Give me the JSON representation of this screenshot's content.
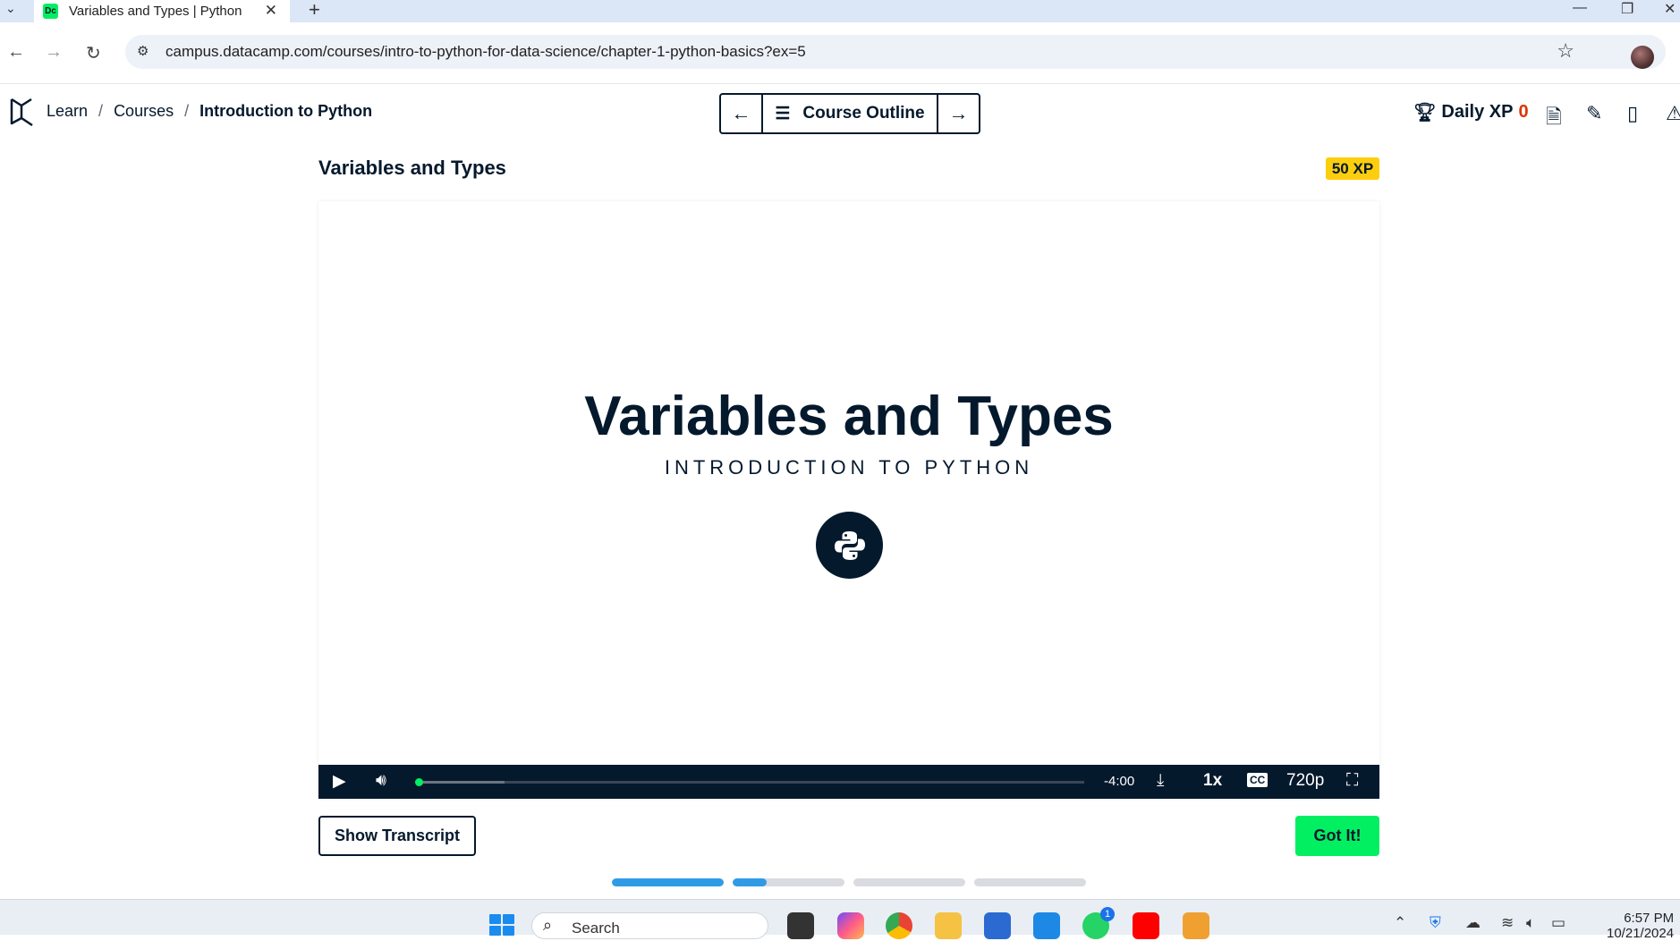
{
  "browser": {
    "tab_title": "Variables and Types | Python",
    "favicon_text": "Dc",
    "url": "campus.datacamp.com/courses/intro-to-python-for-data-science/chapter-1-python-basics?ex=5"
  },
  "header": {
    "breadcrumb": [
      "Learn",
      "Courses",
      "Introduction to Python"
    ],
    "course_outline_label": "Course Outline",
    "daily_xp_label": "Daily XP",
    "daily_xp_value": "0"
  },
  "exercise": {
    "title": "Variables and Types",
    "xp_badge": "50 XP"
  },
  "video": {
    "slide_title": "Variables and Types",
    "slide_subtitle": "INTRODUCTION TO PYTHON",
    "time_remaining": "-4:00",
    "speed": "1x",
    "quality": "720p",
    "progress_fraction": 0.0,
    "buffered_fraction": 0.13
  },
  "actions": {
    "show_transcript": "Show Transcript",
    "got_it": "Got It!"
  },
  "steps": [
    {
      "fill": 1.0
    },
    {
      "fill": 0.3
    },
    {
      "fill": 0.0
    },
    {
      "fill": 0.0
    }
  ],
  "taskbar": {
    "search_placeholder": "Search",
    "clock_time": "6:57 PM",
    "clock_date": "10/21/2024",
    "whatsapp_badge": "1"
  },
  "colors": {
    "brand_green": "#03ef62",
    "navy": "#05192d",
    "xp_yellow": "#fcce0d",
    "progress_blue": "#2f9be6",
    "xp_orange": "#dd3400"
  }
}
